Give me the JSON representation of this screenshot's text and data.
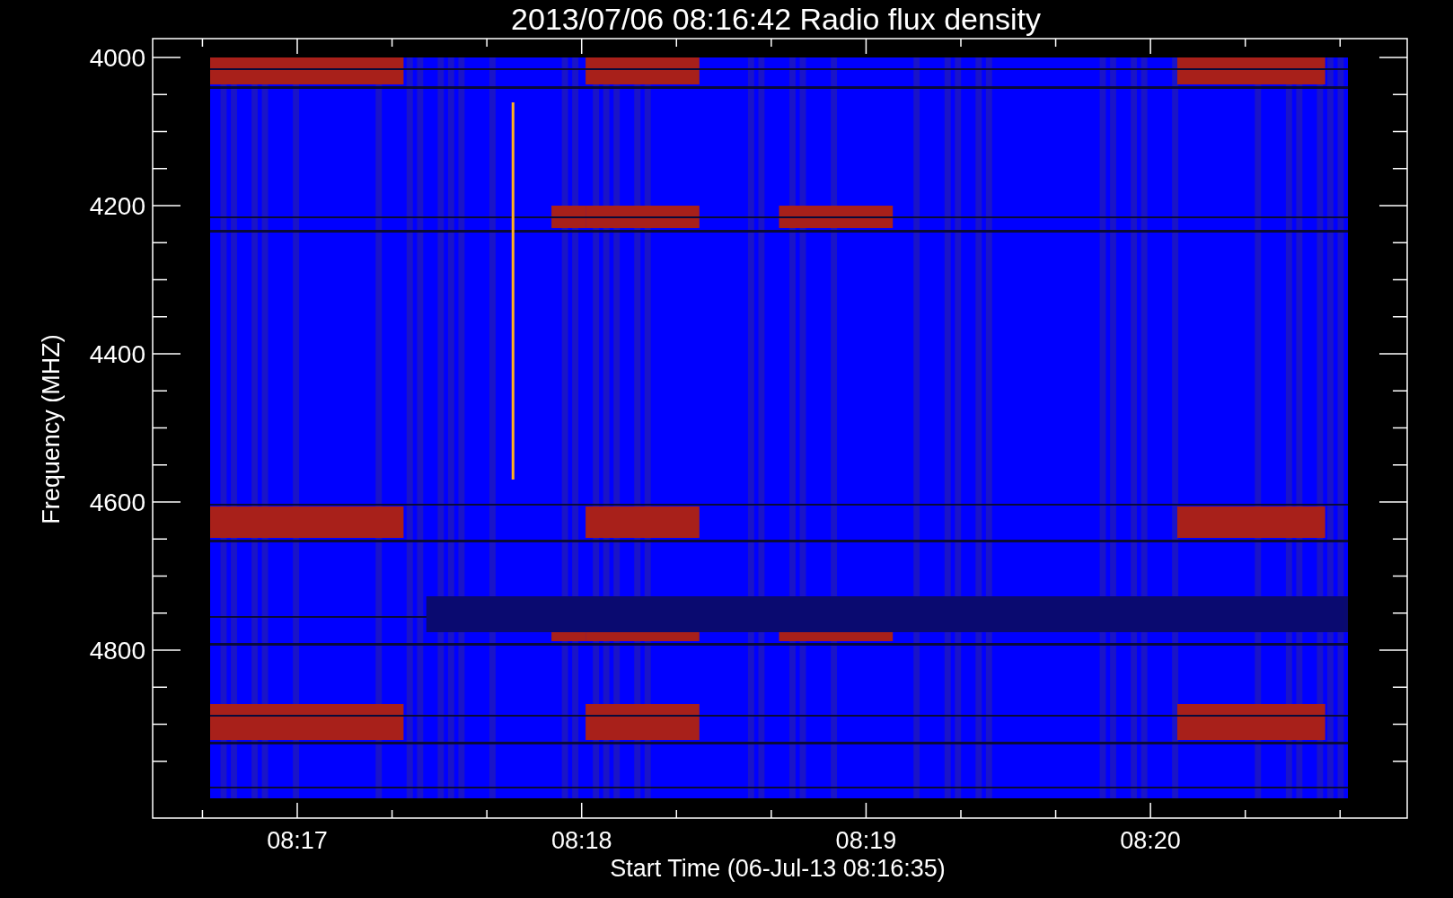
{
  "title": "2013/07/06 08:16:42 Radio flux density",
  "y_axis": {
    "label": "Frequency (MHZ)",
    "ticks": [
      "4000",
      "4200",
      "4400",
      "4600",
      "4800"
    ]
  },
  "x_axis": {
    "label": "Start Time (06-Jul-13 08:16:35)",
    "ticks": [
      "08:17",
      "08:18",
      "08:19",
      "08:20"
    ]
  }
}
